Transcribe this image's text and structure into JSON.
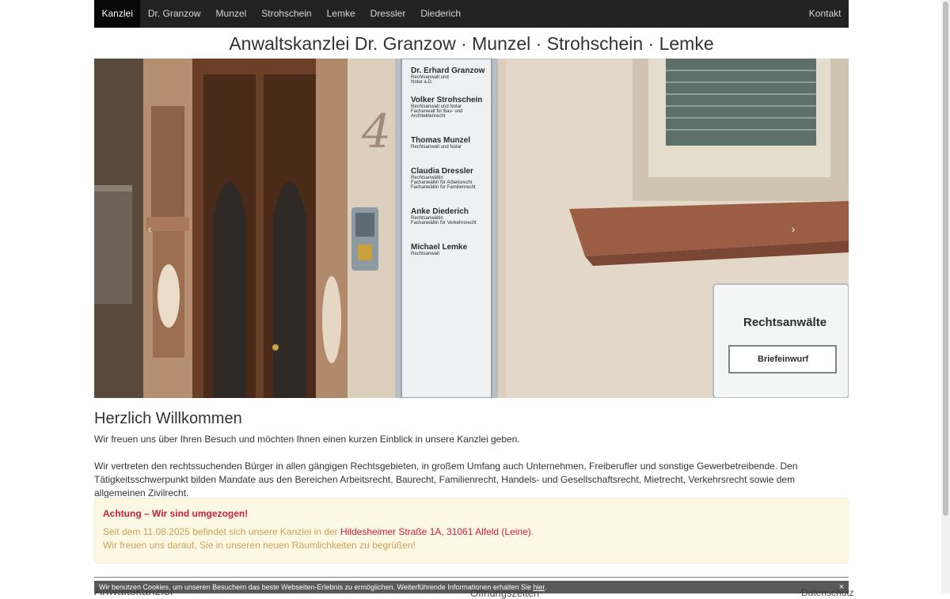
{
  "nav": {
    "items": [
      {
        "label": "Kanzlei",
        "active": true
      },
      {
        "label": "Dr. Granzow"
      },
      {
        "label": "Munzel"
      },
      {
        "label": "Strohschein"
      },
      {
        "label": "Lemke"
      },
      {
        "label": "Dressler"
      },
      {
        "label": "Diederich"
      }
    ],
    "contact_label": "Kontakt"
  },
  "site_title": "Anwaltskanzlei Dr. Granzow · Munzel · Strohschein · Lemke",
  "hero": {
    "prev_label": "‹",
    "next_label": "›",
    "house_number": "4",
    "sign_entries": [
      {
        "name": "Dr. Erhard Granzow",
        "lines": [
          "Rechtsanwalt und",
          "Notar a.D."
        ]
      },
      {
        "name": "Volker Strohschein",
        "lines": [
          "Rechtsanwalt und Notar",
          "Fachanwalt für Bau- und Architektenrecht"
        ]
      },
      {
        "name": "Thomas Munzel",
        "lines": [
          "Rechtsanwalt und Notar"
        ]
      },
      {
        "name": "Claudia Dressler",
        "lines": [
          "Rechtsanwältin",
          "Fachanwältin für Arbeitsrecht",
          "Fachanwältin für Familienrecht"
        ]
      },
      {
        "name": "Anke Diederich",
        "lines": [
          "Rechtsanwältin",
          "Fachanwältin für Verkehrsrecht"
        ]
      },
      {
        "name": "Michael Lemke",
        "lines": [
          "Rechtsanwalt"
        ]
      }
    ],
    "mailbox_title": "Rechtsanwälte",
    "mailbox_slot": "Briefeinwurf"
  },
  "main": {
    "heading": "Herzlich Willkommen",
    "paragraph1": "Wir freuen uns über Ihren Besuch und möchten Ihnen einen kurzen Einblick in unsere Kanzlei geben.",
    "paragraph2": "Wir vertreten den rechtssuchenden Bürger in allen gängigen Rechtsgebieten, in großem Umfang auch Unternehmen, Freiberufler und sonstige Gewerbetreibende. Den Tätigkeitsschwerpunkt bilden Mandate aus den Bereichen Arbeitsrecht, Baurecht, Familienrecht, Handels- und Gesellschaftsrecht, Mietrecht, Verkehrsrecht sowie dem allgemeinen Zivilrecht."
  },
  "notice": {
    "title": "Achtung – Wir sind umgezogen!",
    "line1_prefix": "Seit dem 11.08.2025 befindet sich unsere Kanzlei in der ",
    "line1_link": "Hildesheimer Straße 1A, 31061 Alfeld (Leine)",
    "line1_suffix": ".",
    "line2": "Wir freuen uns darauf, Sie in unseren neuen Räumlichkeiten zu begrüßen!"
  },
  "footer": {
    "left": "Anwaltskanzlei",
    "mid": "Öffnungszeiten",
    "right": "Datenschutz"
  },
  "cookie": {
    "text": "Wir benutzen Cookies, um unseren Besuchern das beste Webseiten-Erlebnis zu ermöglichen. Weiterführende Informationen erhalten Sie ",
    "link": "hier",
    "suffix": ".",
    "close": "×"
  },
  "colors": {
    "nav_bg": "#222222",
    "accent_red": "#cc1f3b",
    "notice_bg": "#fcf8e3",
    "notice_text": "#c9a25a"
  }
}
